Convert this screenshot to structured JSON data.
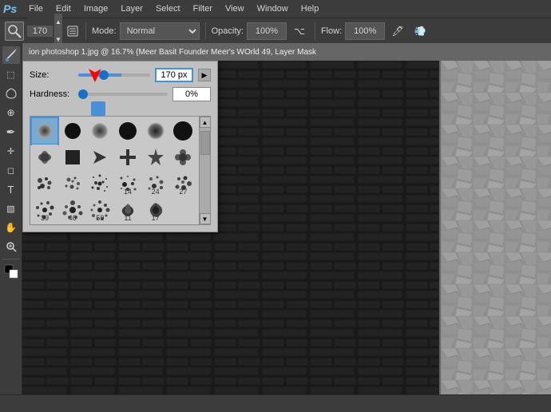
{
  "app": {
    "logo": "Ps",
    "title": "ion photoshop 1.jpg @ 16.7% (Meer Basit Founder Meer's WOrld 49, Layer Mask"
  },
  "menubar": {
    "items": [
      "File",
      "Edit",
      "Image",
      "Layer",
      "Select",
      "Filter",
      "View",
      "Window",
      "Help"
    ]
  },
  "toolbar": {
    "mode_label": "Mode:",
    "mode_value": "Normal",
    "opacity_label": "Opacity:",
    "opacity_value": "100%",
    "flow_label": "Flow:",
    "flow_value": "100%",
    "brush_size": "170",
    "brush_size_display": "170"
  },
  "brush_popup": {
    "size_label": "Size:",
    "size_value": "170 px",
    "hardness_label": "Hardness:",
    "hardness_value": "0%",
    "brushes": [
      {
        "type": "soft-small",
        "label": ""
      },
      {
        "type": "hard-medium",
        "label": ""
      },
      {
        "type": "soft-medium",
        "label": ""
      },
      {
        "type": "hard-large",
        "label": ""
      },
      {
        "type": "soft-large",
        "label": ""
      },
      {
        "type": "hard-xlarge",
        "label": ""
      },
      {
        "type": "special1",
        "label": ""
      },
      {
        "type": "special2",
        "label": ""
      },
      {
        "type": "special3",
        "label": ""
      },
      {
        "type": "special4",
        "label": ""
      },
      {
        "type": "special5",
        "label": ""
      },
      {
        "type": "special6",
        "label": ""
      },
      {
        "type": "special7",
        "label": ""
      },
      {
        "type": "special8",
        "label": ""
      },
      {
        "type": "special9",
        "label": ""
      },
      {
        "type": "special10",
        "label": ""
      },
      {
        "type": "num14",
        "label": "14"
      },
      {
        "type": "num24",
        "label": "24"
      },
      {
        "type": "num27",
        "label": "27"
      },
      {
        "type": "num39",
        "label": "39"
      },
      {
        "type": "num46",
        "label": "46"
      },
      {
        "type": "num59",
        "label": "59"
      },
      {
        "type": "num11",
        "label": "11"
      },
      {
        "type": "num17",
        "label": "17"
      }
    ]
  },
  "left_tools": [
    "✏",
    "✂",
    "⬚",
    "⊕",
    "⊘",
    "✒",
    "◻",
    "T",
    "▧",
    "⬤",
    "✋"
  ],
  "status": {
    "text": ""
  }
}
